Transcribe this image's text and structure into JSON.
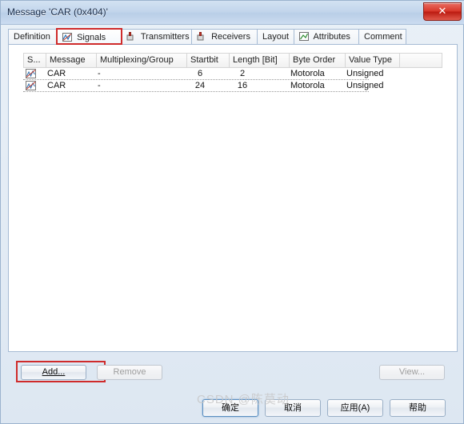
{
  "window": {
    "title": "Message 'CAR (0x404)'",
    "close_label": "✕"
  },
  "tabs": [
    {
      "label": "Definition",
      "icon": "",
      "selected": false
    },
    {
      "label": "Signals",
      "icon": "signal-icon",
      "selected": true
    },
    {
      "label": "Transmitters",
      "icon": "transmitter-icon",
      "selected": false
    },
    {
      "label": "Receivers",
      "icon": "receiver-icon",
      "selected": false
    },
    {
      "label": "Layout",
      "icon": "",
      "selected": false
    },
    {
      "label": "Attributes",
      "icon": "attributes-icon",
      "selected": false
    },
    {
      "label": "Comment",
      "icon": "",
      "selected": false
    }
  ],
  "grid": {
    "columns": [
      "S...",
      "Message",
      "Multiplexing/Group",
      "Startbit",
      "Length [Bit]",
      "Byte Order",
      "Value Type"
    ],
    "rows": [
      {
        "icon": "signal-row-icon",
        "message": "CAR",
        "multiplexing": "-",
        "startbit": "6",
        "length": "2",
        "byte_order": "Motorola",
        "value_type": "Unsigned"
      },
      {
        "icon": "signal-row-icon",
        "message": "CAR",
        "multiplexing": "-",
        "startbit": "24",
        "length": "16",
        "byte_order": "Motorola",
        "value_type": "Unsigned"
      }
    ]
  },
  "buttons": {
    "add": "Add...",
    "remove": "Remove",
    "view": "View...",
    "ok": "确定",
    "cancel": "取消",
    "apply": "应用(A)",
    "help": "帮助"
  },
  "watermark": "CSDN @陈莫动"
}
